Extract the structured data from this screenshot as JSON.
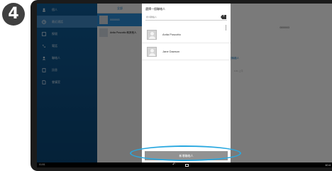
{
  "step": {
    "number": "4"
  },
  "sidebar": {
    "items": [
      {
        "label": "個​人",
        "icon": "profile-icon",
        "active": false
      },
      {
        "label": "最近​通話",
        "icon": "recent-calls-icon",
        "active": true
      },
      {
        "label": "撥號",
        "icon": "dialpad-icon",
        "active": false
      },
      {
        "label": "電話",
        "icon": "phone-icon",
        "active": false
      },
      {
        "label": "聯絡人",
        "icon": "contacts-icon",
        "active": false
      },
      {
        "label": "訊息",
        "icon": "messages-icon",
        "active": false
      },
      {
        "label": "會議室",
        "icon": "meeting-icon",
        "active": false
      }
    ]
  },
  "middle": {
    "tab_label": "全部",
    "conversations": [
      {
        "name": "0000003",
        "selected": true
      },
      {
        "name": "Anita Poscotto 和其他人",
        "selected": false
      }
    ]
  },
  "right": {
    "number": "0000003",
    "green_button": "回電",
    "link_button": "新增至聯絡人",
    "faint_text": "1:01 上午"
  },
  "dialog": {
    "title": "選擇一個聯絡人",
    "search_placeholder": "搜尋聯絡人",
    "contacts": [
      {
        "name": "Anita Poscotto"
      },
      {
        "name": "Jane Dawson"
      }
    ],
    "new_contact_button": "新增聯絡人"
  },
  "navbar": {
    "left_text": "01/01",
    "right_status": "10:4",
    "back_glyph": "↶"
  },
  "colors": {
    "sidebar": "#0f5c97",
    "highlight": "#29a8e0",
    "green": "#3cb34a"
  }
}
